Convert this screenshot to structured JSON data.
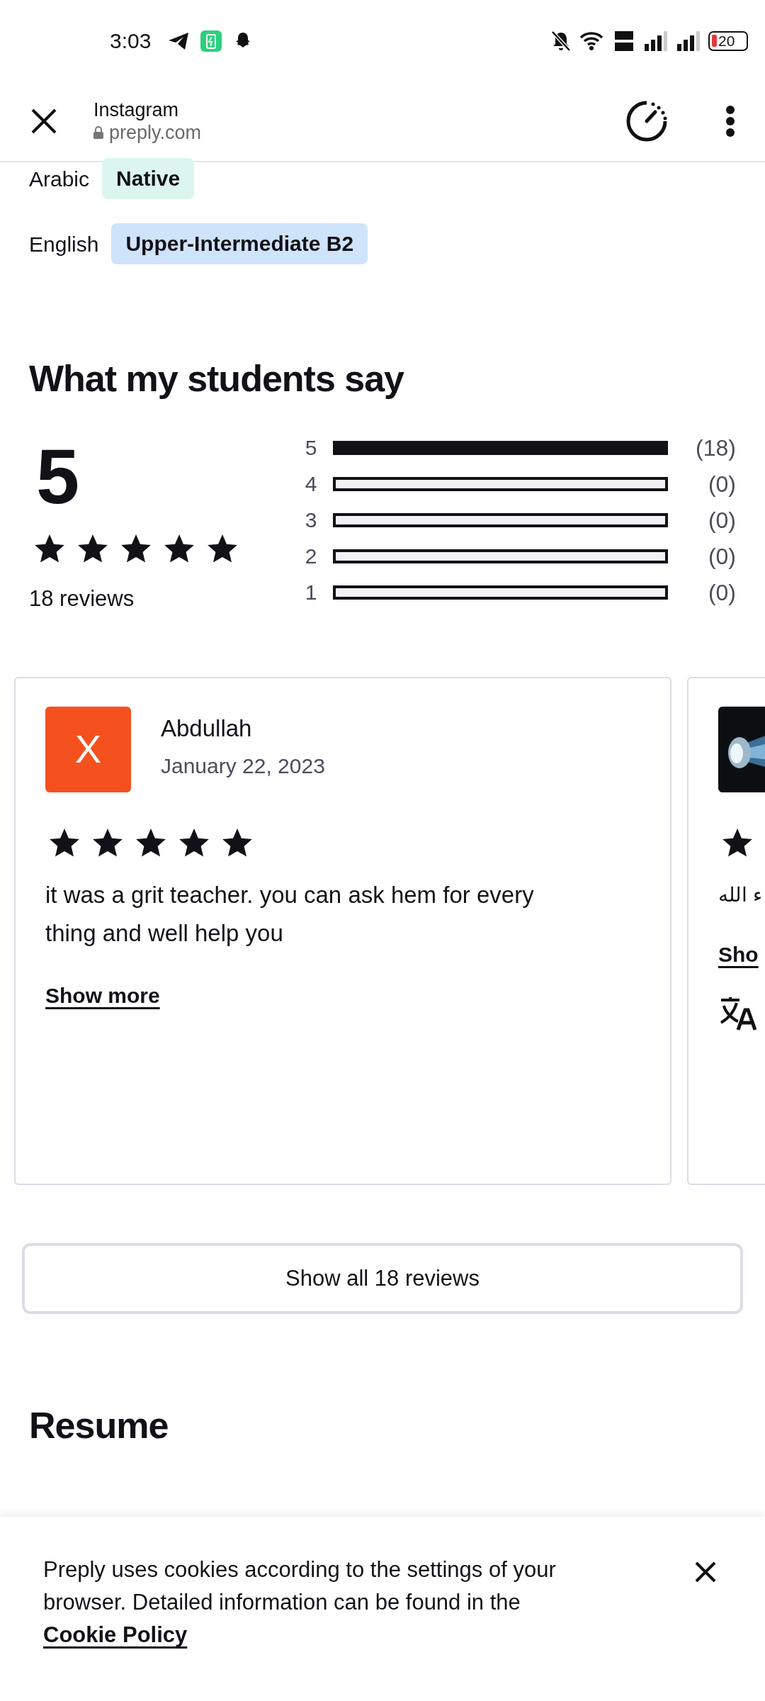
{
  "status_bar": {
    "time": "3:03",
    "battery": "20"
  },
  "browser": {
    "title": "Instagram",
    "url": "preply.com"
  },
  "languages": [
    {
      "language": "Arabic",
      "level": "Native",
      "color": "#dcf6ef"
    },
    {
      "language": "English",
      "level": "Upper-Intermediate B2",
      "color": "#cfe3fb"
    }
  ],
  "reviews_section": {
    "title": "What my students say",
    "average": "5",
    "stars": 5,
    "count_label": "18 reviews",
    "bars": [
      {
        "label": "5",
        "filled": true,
        "count": "(18)"
      },
      {
        "label": "4",
        "filled": false,
        "count": "(0)"
      },
      {
        "label": "3",
        "filled": false,
        "count": "(0)"
      },
      {
        "label": "2",
        "filled": false,
        "count": "(0)"
      },
      {
        "label": "1",
        "filled": false,
        "count": "(0)"
      }
    ]
  },
  "reviews": [
    {
      "avatar": {
        "kind": "letter",
        "letter": "X",
        "color": "#f4511e"
      },
      "name": "Abdullah",
      "date": "January 22, 2023",
      "stars": 5,
      "text": "it was a grit teacher. you can ask hem for every thing and well help you",
      "more": "Show more",
      "translate": false
    },
    {
      "star_icon": true,
      "text": "ء الله",
      "more": "Sho",
      "translate": true
    }
  ],
  "show_all": "Show all 18 reviews",
  "resume_title": "Resume",
  "cookie_banner": {
    "text": "Preply uses cookies according to the settings of your browser. Detailed information can be found in the ",
    "link": "Cookie Policy"
  }
}
